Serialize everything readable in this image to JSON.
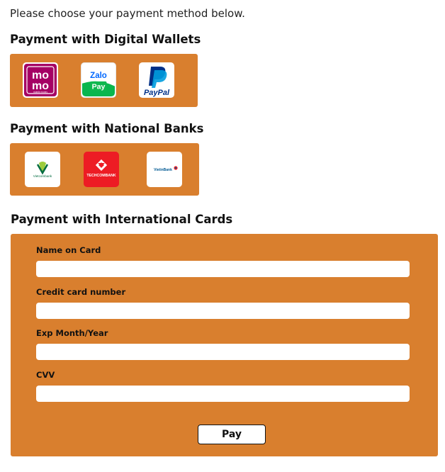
{
  "intro_text": "Please choose your payment method below.",
  "digital_wallets": {
    "title": "Payment with Digital Wallets",
    "items": [
      {
        "name": "MoMo",
        "logo_text": "mo mo",
        "tagline": "mobile money",
        "color": "#a50064"
      },
      {
        "name": "ZaloPay",
        "logo_text": "Zalo Pay",
        "color": "#0068ff"
      },
      {
        "name": "PayPal",
        "logo_text": "PayPal",
        "color": "#003087"
      }
    ]
  },
  "national_banks": {
    "title": "Payment with National Banks",
    "items": [
      {
        "name": "Vietcombank",
        "logo_text": "Vietcombank",
        "color": "#006b3f"
      },
      {
        "name": "Techcombank",
        "logo_text": "TECHCOMBANK",
        "color": "#ed1c24"
      },
      {
        "name": "VietinBank",
        "logo_text": "VietinBank",
        "color": "#005993"
      }
    ]
  },
  "international_cards": {
    "title": "Payment with International Cards",
    "fields": [
      {
        "label": "Name on Card",
        "value": "",
        "placeholder": ""
      },
      {
        "label": "Credit card number",
        "value": "",
        "placeholder": ""
      },
      {
        "label": "Exp Month/Year",
        "value": "",
        "placeholder": ""
      },
      {
        "label": "CVV",
        "value": "",
        "placeholder": ""
      }
    ],
    "pay_label": "Pay"
  },
  "colors": {
    "panel": "#d97f2e",
    "text": "#111111"
  }
}
